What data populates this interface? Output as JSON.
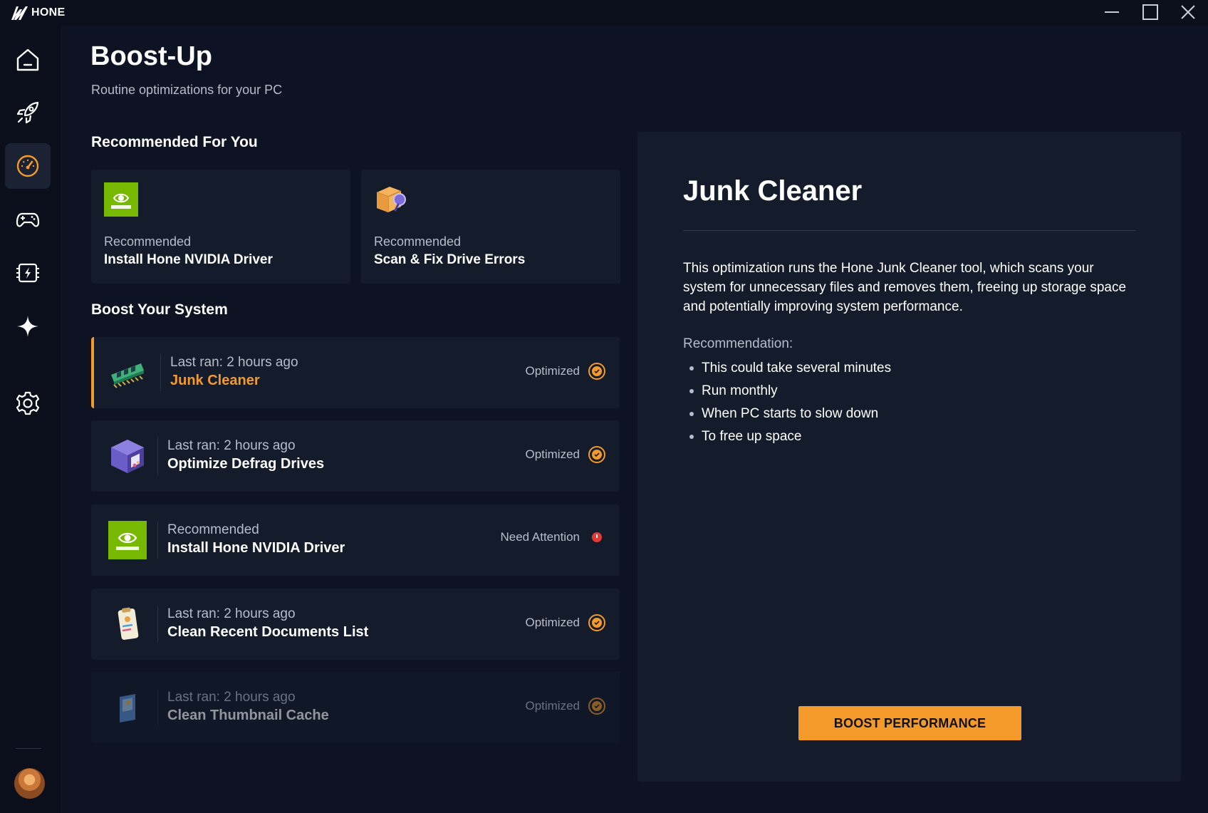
{
  "app": {
    "name": "HONE"
  },
  "colors": {
    "accent": "#f39a2a",
    "alert": "#e53935",
    "background": "#0d1322",
    "card": "#141c2c"
  },
  "sidebar": {
    "items": [
      {
        "icon": "home-icon"
      },
      {
        "icon": "rocket-icon"
      },
      {
        "icon": "speedometer-icon",
        "active": true
      },
      {
        "icon": "gamepad-icon"
      },
      {
        "icon": "cpu-bolt-icon"
      },
      {
        "icon": "sparkle-icon"
      },
      {
        "icon": "gear-icon"
      }
    ]
  },
  "header": {
    "title": "Boost-Up",
    "subtitle": "Routine optimizations for your PC"
  },
  "recommended": {
    "section_title": "Recommended For You",
    "cards": [
      {
        "icon": "nvidia-icon",
        "label": "Recommended",
        "title": "Install Hone NVIDIA Driver"
      },
      {
        "icon": "drive-scan-icon",
        "label": "Recommended",
        "title": "Scan & Fix Drive Errors"
      }
    ]
  },
  "boost": {
    "section_title": "Boost Your System",
    "rows": [
      {
        "icon": "ram-icon",
        "subtitle": "Last ran: 2 hours ago",
        "title": "Junk Cleaner",
        "status": "Optimized",
        "state": "ok",
        "selected": true
      },
      {
        "icon": "defrag-cube-icon",
        "subtitle": "Last ran: 2 hours ago",
        "title": "Optimize Defrag Drives",
        "status": "Optimized",
        "state": "ok"
      },
      {
        "icon": "nvidia-icon",
        "subtitle": "Recommended",
        "title": "Install Hone NVIDIA Driver",
        "status": "Need Attention",
        "state": "alert"
      },
      {
        "icon": "documents-icon",
        "subtitle": "Last ran: 2 hours ago",
        "title": "Clean Recent Documents List",
        "status": "Optimized",
        "state": "ok"
      },
      {
        "icon": "thumbnail-icon",
        "subtitle": "Last ran: 2 hours ago",
        "title": "Clean Thumbnail Cache",
        "status": "Optimized",
        "state": "ok"
      }
    ]
  },
  "detail": {
    "title": "Junk Cleaner",
    "description": "This optimization runs the Hone Junk Cleaner tool, which scans your system for unnecessary files and removes them, freeing up storage space and potentially improving system performance.",
    "recommendation_label": "Recommendation:",
    "recommendations": [
      "This could take several minutes",
      "Run monthly",
      "When PC starts to slow down",
      "To free up space"
    ],
    "button_label": "BOOST PERFORMANCE"
  }
}
